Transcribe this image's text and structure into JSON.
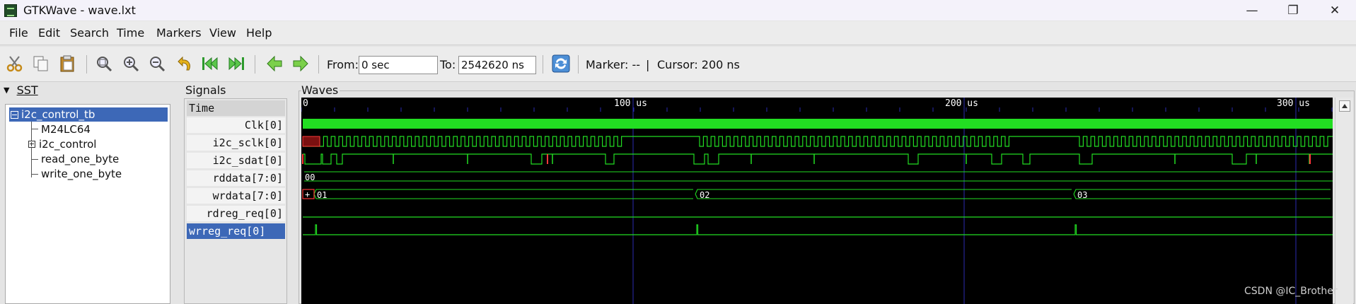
{
  "window": {
    "title": "GTKWave - wave.lxt",
    "controls": [
      "—",
      "❐",
      "✕"
    ]
  },
  "menu": [
    "File",
    "Edit",
    "Search",
    "Time",
    "Markers",
    "View",
    "Help"
  ],
  "toolbar": {
    "from_label": "From:",
    "from_value": "0 sec",
    "to_label": "To:",
    "to_value": "2542620 ns",
    "marker_text": "Marker: --",
    "divider": "|",
    "cursor_text": "Cursor: 200 ns"
  },
  "sst": {
    "title": "SST",
    "root": "i2c_control_tb",
    "children": [
      "M24LC64",
      "i2c_control",
      "read_one_byte",
      "write_one_byte"
    ]
  },
  "signals": {
    "title": "Signals",
    "time_label": "Time",
    "names": [
      "Clk[0]",
      "i2c_sclk[0]",
      "i2c_sdat[0]",
      "rddata[7:0]",
      "wrdata[7:0]",
      "rdreg_req[0]",
      "wrreg_req[0]"
    ]
  },
  "waves": {
    "title": "Waves",
    "axis_start": "0",
    "axis_labels": [
      "100 us",
      "200 us",
      "300 us"
    ],
    "rddata_value": "00",
    "wrdata_marker": "+",
    "wrdata_values": [
      "01",
      "02",
      "03"
    ],
    "colors": {
      "background": "#000000",
      "trace": "#22dd22",
      "grid": "#2a2ab0",
      "highlight": "#ff3a3a"
    }
  },
  "watermark": "CSDN @IC_Brother"
}
